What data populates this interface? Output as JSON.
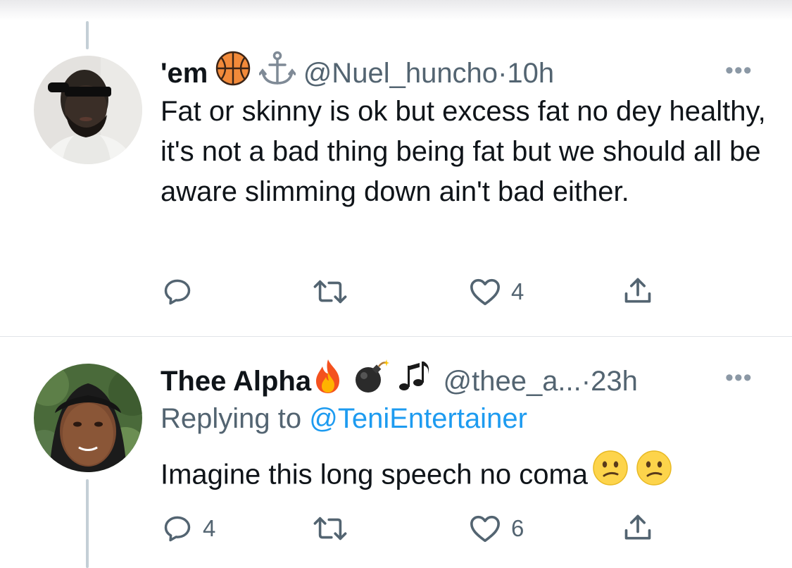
{
  "tweets": [
    {
      "name": "'em",
      "name_emojis": [
        "basketball-icon",
        "anchor-icon"
      ],
      "handle": "@Nuel_huncho",
      "separator": "·",
      "time": "10h",
      "more": "•••",
      "text": "Fat or skinny is ok but excess fat no dey healthy, it's not a bad thing being fat but we should all be aware slimming down ain't bad either.",
      "actions": {
        "replies": "",
        "retweets": "",
        "likes": "4"
      }
    },
    {
      "name": "Thee Alpha",
      "name_emojis": [
        "fire-icon",
        "bomb-icon",
        "musical-notes-icon"
      ],
      "handle": "@thee_a...",
      "separator": "·",
      "time": "23h",
      "more": "•••",
      "replying_prefix": "Replying to ",
      "replying_to": "@TeniEntertainer",
      "text": "Imagine this long speech no coma",
      "text_emojis": [
        "confused-face-icon",
        "confused-face-icon"
      ],
      "actions": {
        "replies": "4",
        "retweets": "",
        "likes": "6"
      }
    }
  ],
  "colors": {
    "text": "#0f1419",
    "secondary": "#536471",
    "link": "#1d9bf0",
    "thread": "#c4cfd6"
  }
}
